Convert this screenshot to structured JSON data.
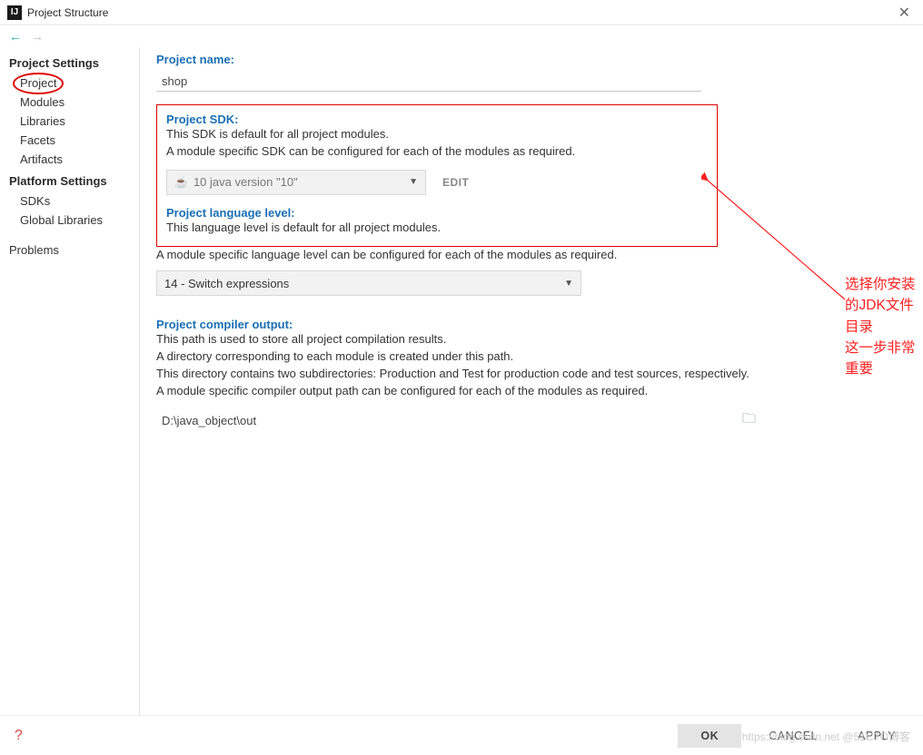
{
  "window": {
    "title": "Project Structure"
  },
  "sidebar": {
    "settings_header": "Project Settings",
    "project": "Project",
    "modules": "Modules",
    "libraries": "Libraries",
    "facets": "Facets",
    "artifacts": "Artifacts",
    "platform_header": "Platform Settings",
    "sdks": "SDKs",
    "global_libs": "Global Libraries",
    "problems": "Problems"
  },
  "form": {
    "name_label": "Project name:",
    "name_value": "shop",
    "sdk_label": "Project SDK:",
    "sdk_desc1": "This SDK is default for all project modules.",
    "sdk_desc2": "A module specific SDK can be configured for each of the modules as required.",
    "sdk_selected": "10 java version \"10\"",
    "edit": "EDIT",
    "lang_label": "Project language level:",
    "lang_desc1": "This language level is default for all project modules.",
    "lang_desc2": "A module specific language level can be configured for each of the modules as required.",
    "lang_selected": "14 - Switch expressions",
    "output_label": "Project compiler output:",
    "output_desc1": "This path is used to store all project compilation results.",
    "output_desc2": "A directory corresponding to each module is created under this path.",
    "output_desc3": "This directory contains two subdirectories: Production and Test for production code and test sources, respectively.",
    "output_desc4": "A module specific compiler output path can be configured for each of the modules as required.",
    "output_path": "D:\\java_object\\out"
  },
  "annotation": {
    "line1": "选择你安装的JDK文件目录",
    "line2": "这一步非常重要"
  },
  "buttons": {
    "ok": "OK",
    "cancel": "CANCEL",
    "apply": "APPLY"
  },
  "watermark": "https://blog.csdn.net @51CTO博客"
}
